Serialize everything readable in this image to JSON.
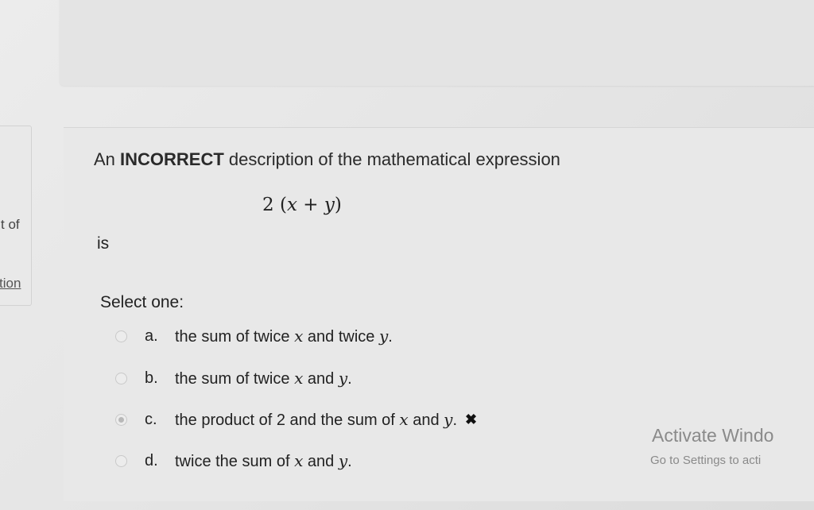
{
  "sidebar": {
    "text1": "t of",
    "text2": "tion"
  },
  "question": {
    "prefix": "An ",
    "emphasis": "INCORRECT",
    "suffix": " description of the mathematical expression",
    "expression": {
      "coef": "2",
      "open": "(",
      "x": "x",
      "plus": " + ",
      "y": "y",
      "close": ")"
    },
    "is_label": "is",
    "select_label": "Select one:"
  },
  "options": [
    {
      "letter": "a.",
      "text_before": "the sum of twice ",
      "var1": "x",
      "text_mid": " and twice ",
      "var2": "y",
      "text_end": ".",
      "selected": false
    },
    {
      "letter": "b.",
      "text_before": "the sum of twice ",
      "var1": "x",
      "text_mid": " and ",
      "var2": "y",
      "text_end": ".",
      "selected": false
    },
    {
      "letter": "c.",
      "text_before": "the product of 2 and the sum of ",
      "var1": "x",
      "text_mid": " and ",
      "var2": "y",
      "text_end": ".",
      "selected": true,
      "mark": "✖"
    },
    {
      "letter": "d.",
      "text_before": "twice the sum of ",
      "var1": "x",
      "text_mid": " and ",
      "var2": "y",
      "text_end": ".",
      "selected": false
    }
  ],
  "watermark": {
    "title": "Activate Windo",
    "subtitle": "Go to Settings to acti"
  }
}
